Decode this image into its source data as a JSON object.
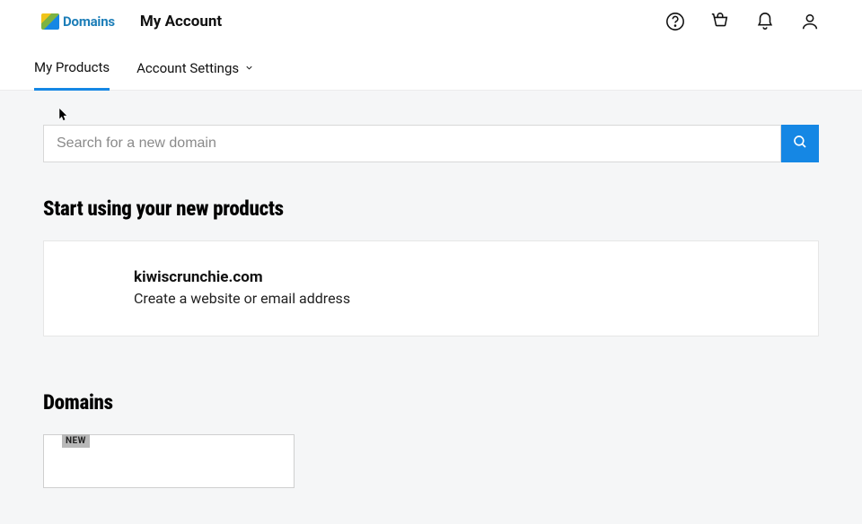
{
  "header": {
    "logo_text": "Domains",
    "title": "My Account"
  },
  "tabs": {
    "my_products": "My Products",
    "account_settings": "Account Settings"
  },
  "search": {
    "placeholder": "Search for a new domain"
  },
  "section1": {
    "heading": "Start using your new products",
    "card_title": "kiwiscrunchie.com",
    "card_sub": "Create a website or email address"
  },
  "section2": {
    "heading": "Domains",
    "badge": "NEW"
  }
}
